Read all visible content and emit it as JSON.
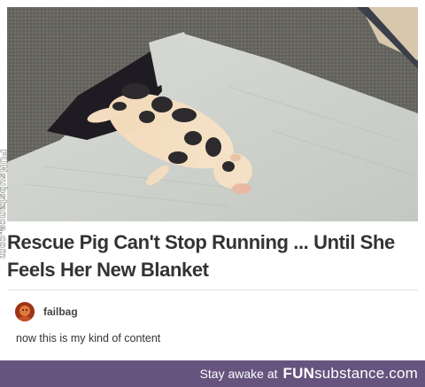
{
  "post": {
    "headline": "Rescue Pig Can't Stop Running ... Until She Feels Her New Blanket",
    "username": "failbag",
    "comment": "now this is my kind of content"
  },
  "watermark": {
    "side_text": "FUNsubstance.com"
  },
  "footer": {
    "tagline": "Stay awake at",
    "logo_bold": "FUN",
    "logo_rest": "substance.com"
  },
  "colors": {
    "footer_bg": "#66547e",
    "headline": "#333333"
  },
  "icons": {
    "avatar": "avatar-icon"
  }
}
